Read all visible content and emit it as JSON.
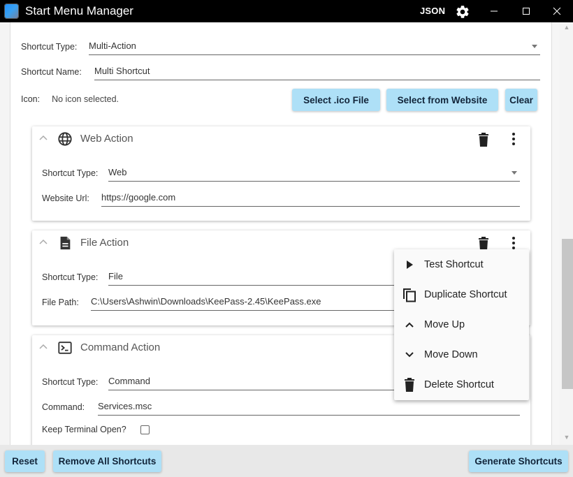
{
  "window": {
    "title": "Start Menu Manager",
    "json_label": "JSON",
    "icons": {
      "settings": "gear-icon",
      "minimize": "minimize-icon",
      "maximize": "maximize-icon",
      "close": "close-icon"
    }
  },
  "form": {
    "shortcut_type_label": "Shortcut Type:",
    "shortcut_type_value": "Multi-Action",
    "shortcut_name_label": "Shortcut Name:",
    "shortcut_name_value": "Multi Shortcut",
    "icon_label": "Icon:",
    "icon_status": "No icon selected.",
    "buttons": {
      "select_ico": "Select .ico File",
      "select_website": "Select from Website",
      "clear": "Clear"
    }
  },
  "actions": [
    {
      "title": "Web Action",
      "icon": "globe-icon",
      "fields": [
        {
          "label": "Shortcut Type:",
          "value": "Web",
          "type": "select"
        },
        {
          "label": "Website Url:",
          "value": "https://google.com",
          "type": "text"
        }
      ]
    },
    {
      "title": "File Action",
      "icon": "file-icon",
      "fields": [
        {
          "label": "Shortcut Type:",
          "value": "File",
          "type": "select"
        },
        {
          "label": "File Path:",
          "value": "C:\\Users\\Ashwin\\Downloads\\KeePass-2.45\\KeePass.exe",
          "type": "text"
        }
      ]
    },
    {
      "title": "Command Action",
      "icon": "terminal-icon",
      "fields": [
        {
          "label": "Shortcut Type:",
          "value": "Command",
          "type": "select"
        },
        {
          "label": "Command:",
          "value": "Services.msc",
          "type": "text"
        }
      ],
      "checkbox": {
        "label": "Keep Terminal Open?",
        "checked": false
      }
    }
  ],
  "context_menu": {
    "items": [
      {
        "label": "Test Shortcut",
        "icon": "play-icon"
      },
      {
        "label": "Duplicate Shortcut",
        "icon": "copy-icon"
      },
      {
        "label": "Move Up",
        "icon": "chevron-up-icon"
      },
      {
        "label": "Move Down",
        "icon": "chevron-down-icon"
      },
      {
        "label": "Delete Shortcut",
        "icon": "trash-icon"
      }
    ]
  },
  "bottom": {
    "reset": "Reset",
    "remove_all": "Remove All Shortcuts",
    "generate": "Generate Shortcuts"
  },
  "colors": {
    "titlebar": "#000000",
    "button_bg": "#aee0f7",
    "button_text": "#12253a"
  }
}
